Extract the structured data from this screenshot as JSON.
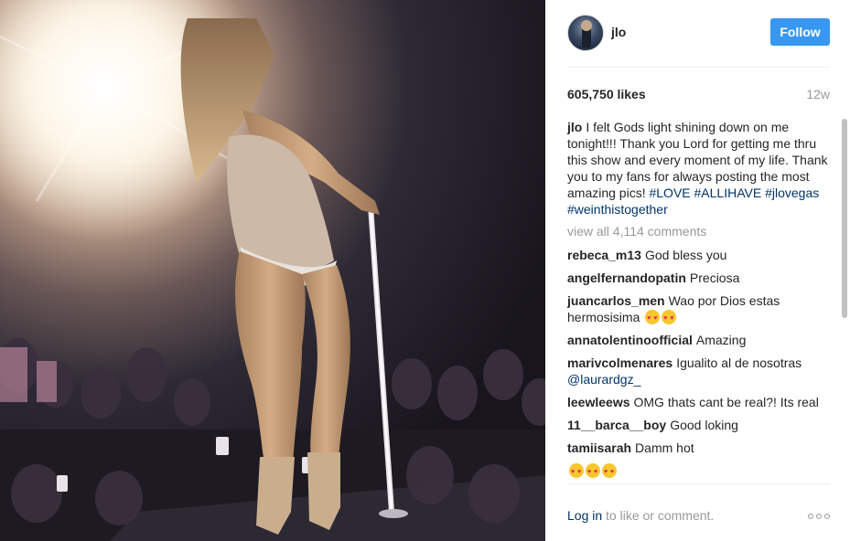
{
  "post": {
    "username": "jlo",
    "follow_label": "Follow",
    "likes": "605,750 likes",
    "age": "12w",
    "caption": {
      "user": "jlo",
      "text": "I felt Gods light shining down on me tonight!!! Thank you Lord for getting me thru this show and every moment of my life. Thank you to my fans for always posting the most amazing pics!",
      "tags": [
        "#LOVE",
        "#ALLIHAVE",
        "#jlovegas",
        "#weinthistogether"
      ]
    },
    "view_all": "view all 4,114 comments",
    "comments": [
      {
        "user": "rebeca_m13",
        "text": "God bless you"
      },
      {
        "user": "angelfernandopatin",
        "text": "Preciosa"
      },
      {
        "user": "juancarlos_men",
        "text": "Wao por Dios estas hermosisima"
      },
      {
        "user": "annatolentinoofficial",
        "text": "Amazing"
      },
      {
        "user": "marivcolmenares",
        "text": "Igualito al de nosotras",
        "mention": "@laurardgz_"
      },
      {
        "user": "leewleews",
        "text": "OMG thats cant be real?! Its real"
      },
      {
        "user": "11__barca__boy",
        "text": "Good loking"
      },
      {
        "user": "tamiisarah",
        "text": "Damm hot"
      }
    ],
    "emoji_icon": "heart-eyes-emoji",
    "footer": {
      "login_link": "Log in",
      "login_rest": "to like or comment.",
      "more_icon": "more-options-icon"
    }
  },
  "colors": {
    "follow_button": "#3897f0",
    "hashtag": "#003569",
    "muted": "#999999"
  }
}
